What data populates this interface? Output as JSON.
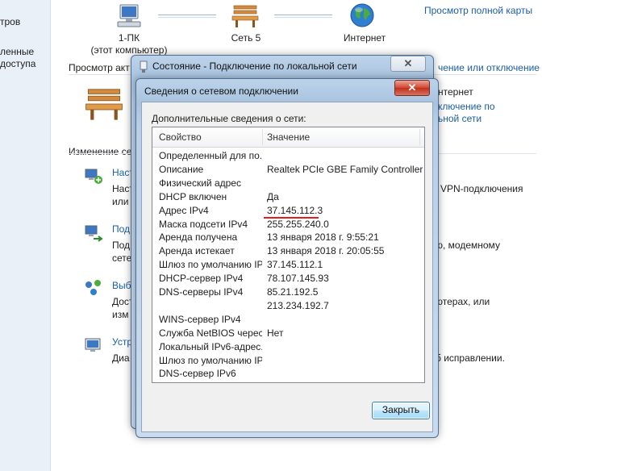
{
  "left_nav": {
    "items": [
      "тров",
      "ленные",
      "доступа"
    ]
  },
  "network_map": {
    "nodes": [
      {
        "label": "1-ПК",
        "sublabel": "(этот компьютер)",
        "icon": "computer-icon"
      },
      {
        "label": "Сеть  5",
        "icon": "bench-icon"
      },
      {
        "label": "Интернет",
        "icon": "globe-icon"
      }
    ],
    "full_map_link": "Просмотр полной карты"
  },
  "background": {
    "view_active_label": "Просмотр акт",
    "connect_disconnect_link": "чение или отключение",
    "network_type_text": "нтернет",
    "connection_link_1": "ключение по",
    "connection_link_2": "ьной сети",
    "change_settings_label": "Изменение се",
    "tasks": [
      {
        "icon": "network-setup-icon",
        "title": "Наст",
        "desc1": "Наст",
        "desc1_right": "VPN-подключения",
        "desc2": "или"
      },
      {
        "icon": "network-connect-icon",
        "title": "Под",
        "desc1": "Под",
        "desc1_right": "ю, модемному",
        "desc2": "сете"
      },
      {
        "icon": "homegroup-icon",
        "title": "Выб",
        "desc1": "Дост",
        "desc1_right": "ютерах, или",
        "desc2": "изм"
      },
      {
        "icon": "troubleshoot-icon",
        "title": "Устр",
        "desc1": "Диа",
        "desc1_right": "б исправлении.",
        "desc2": ""
      }
    ]
  },
  "status_dialog": {
    "title": "Состояние - Подключение по локальной сети",
    "close": "✕"
  },
  "details_dialog": {
    "title": "Сведения о сетевом подключении",
    "close": "✕",
    "caption": "Дополнительные сведения о сети:",
    "columns": {
      "property": "Свойство",
      "value": "Значение"
    },
    "rows": [
      {
        "property": "Определенный для по...",
        "value": ""
      },
      {
        "property": "Описание",
        "value": "Realtek PCIe GBE Family Controller"
      },
      {
        "property": "Физический адрес",
        "value": ""
      },
      {
        "property": "DHCP включен",
        "value": "Да"
      },
      {
        "property": "Адрес IPv4",
        "value": "37.145.112.3"
      },
      {
        "property": "Маска подсети IPv4",
        "value": "255.255.240.0"
      },
      {
        "property": "Аренда получена",
        "value": "13 января 2018 г. 9:55:21"
      },
      {
        "property": "Аренда истекает",
        "value": "13 января 2018 г. 20:05:55"
      },
      {
        "property": "Шлюз по умолчанию IP...",
        "value": "37.145.112.1"
      },
      {
        "property": "DHCP-сервер IPv4",
        "value": "78.107.145.93"
      },
      {
        "property": "DNS-серверы IPv4",
        "value": "85.21.192.5"
      },
      {
        "property": "",
        "value": "213.234.192.7"
      },
      {
        "property": "WINS-сервер IPv4",
        "value": ""
      },
      {
        "property": "Служба NetBIOS черес...",
        "value": "Нет"
      },
      {
        "property": "Локальный IPv6-адрес...",
        "value": ""
      },
      {
        "property": "Шлюз по умолчанию IP...",
        "value": ""
      },
      {
        "property": "DNS-сервер IPv6",
        "value": ""
      }
    ],
    "highlighted_row_index": 4,
    "highlight_color": "#e0201a",
    "close_button": "Закрыть"
  }
}
